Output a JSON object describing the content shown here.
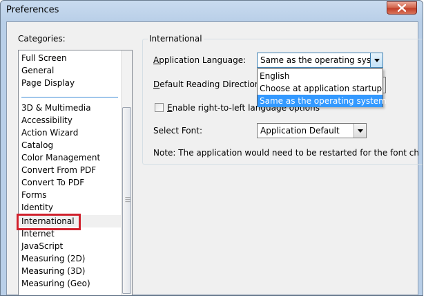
{
  "window": {
    "title": "Preferences"
  },
  "categories": {
    "label": "Categories:",
    "top_items": [
      "Full Screen",
      "General",
      "Page Display"
    ],
    "items": [
      "3D & Multimedia",
      "Accessibility",
      "Action Wizard",
      "Catalog",
      "Color Management",
      "Convert From PDF",
      "Convert To PDF",
      "Forms",
      "Identity",
      "International",
      "Internet",
      "JavaScript",
      "Measuring (2D)",
      "Measuring (3D)",
      "Measuring (Geo)"
    ],
    "selected": "International"
  },
  "panel": {
    "group_title": "International",
    "app_language": {
      "label_prefix": "A",
      "label_rest": "pplication Language:",
      "value": "Same as the operating system",
      "options": [
        "English",
        "Choose at application startup",
        "Same as the operating system"
      ]
    },
    "reading_direction": {
      "label_prefix": "D",
      "label_rest": "efault Reading Direction:"
    },
    "rtl_option": {
      "label_prefix": "E",
      "label_rest": "nable right-to-left language options"
    },
    "select_font": {
      "label": "Select Font:",
      "value": "Application Default"
    },
    "note": "Note: The application would need to be restarted for the font change to b"
  },
  "colors": {
    "selection": "#3399ff",
    "highlight_box": "#d0202c"
  }
}
